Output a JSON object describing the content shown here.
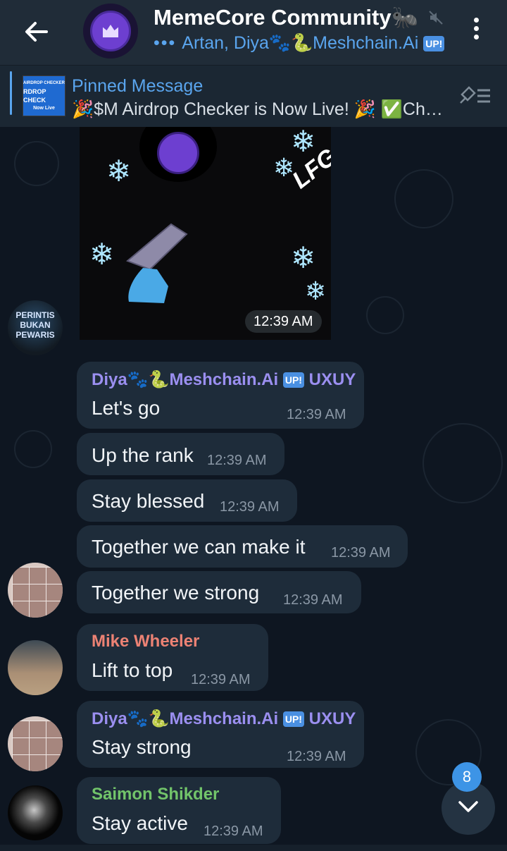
{
  "header": {
    "title": "MemeCore Community🐜",
    "subtitle": "Artan, Diya🐾🐍Meshchain.Ai",
    "subtitle_dots": "•••",
    "subtitle_badge": "UP!",
    "icons": [
      "back-arrow-icon",
      "mute-icon",
      "more-vert-icon"
    ]
  },
  "pinned": {
    "label": "Pinned Message",
    "text": "🎉$M Airdrop Checker is Now Live! 🎉 ✅Ch…",
    "thumb_line1": "AIRDROP CHECKER",
    "thumb_line2": "RDROP CHECK",
    "thumb_line3": "Now Live"
  },
  "media": {
    "time": "12:39 AM",
    "overlay_text": "LFG"
  },
  "avatar1_text": "PERINTIS BUKAN PEWARIS",
  "messages": [
    {
      "name": "Diya🐾🐍Meshchain.Ai",
      "badge": "UP!",
      "name_suffix": "UXUY",
      "text": "Let's go",
      "time": "12:39 AM"
    },
    {
      "text": "Up the rank",
      "time": "12:39 AM"
    },
    {
      "text": "Stay blessed",
      "time": "12:39 AM"
    },
    {
      "text": "Together we can make it",
      "time": "12:39 AM"
    },
    {
      "text": "Together we strong",
      "time": "12:39 AM"
    },
    {
      "name": "Mike Wheeler",
      "text": "Lift to top",
      "time": "12:39 AM"
    },
    {
      "name": "Diya🐾🐍Meshchain.Ai",
      "badge": "UP!",
      "name_suffix": "UXUY",
      "text": "Stay strong",
      "time": "12:39 AM"
    },
    {
      "name": "Saimon Shikder",
      "text": "Stay active",
      "time": "12:39 AM"
    }
  ],
  "scroll_down": {
    "unread_count": "8"
  },
  "colors": {
    "header_bg": "#202c38",
    "chat_bg": "#0e1621",
    "bubble_bg": "#1e2c3a",
    "link_blue": "#5aa5ee",
    "name_purple": "#9b8ff0",
    "name_red": "#ec8274",
    "name_green": "#72c46a"
  }
}
